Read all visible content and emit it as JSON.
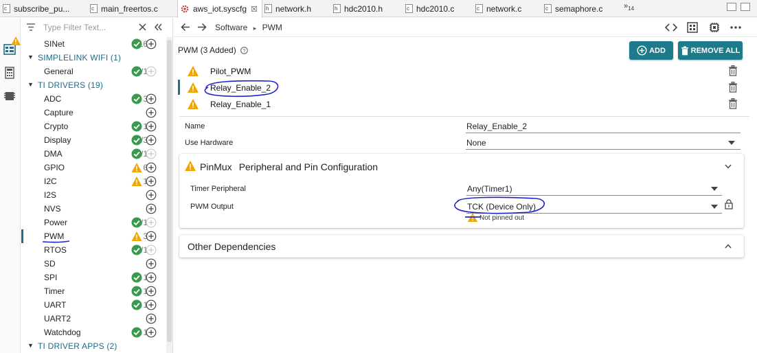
{
  "tabs": [
    {
      "label": "subscribe_pu...",
      "type": "c"
    },
    {
      "label": "main_freertos.c",
      "type": "c"
    },
    {
      "label": "aws_iot.syscfg",
      "type": "cfg",
      "active": true,
      "close": "☒"
    },
    {
      "label": "network.h",
      "type": "h"
    },
    {
      "label": "hdc2010.h",
      "type": "h"
    },
    {
      "label": "hdc2010.c",
      "type": "c"
    },
    {
      "label": "network.c",
      "type": "c"
    },
    {
      "label": "semaphore.c",
      "type": "c"
    }
  ],
  "tab_overflow": {
    "symbol": "»",
    "count": "14"
  },
  "filter": {
    "placeholder": "Type Filter Text..."
  },
  "tree": {
    "rows": [
      {
        "kind": "item",
        "name": "SINet",
        "count": "1/16",
        "status": "ok",
        "add": "active"
      },
      {
        "kind": "cat",
        "name": "SIMPLELINK WIFI (1)"
      },
      {
        "kind": "item",
        "name": "General",
        "count": "1/1",
        "status": "ok",
        "add": "disabled"
      },
      {
        "kind": "cat",
        "name": "TI DRIVERS (19)"
      },
      {
        "kind": "item",
        "name": "ADC",
        "count": "3",
        "status": "ok",
        "add": "active"
      },
      {
        "kind": "item",
        "name": "Capture",
        "count": "",
        "status": "none",
        "add": "active"
      },
      {
        "kind": "item",
        "name": "Crypto",
        "count": "1",
        "status": "ok",
        "add": "active"
      },
      {
        "kind": "item",
        "name": "Display",
        "count": "1/3",
        "status": "ok",
        "add": "active"
      },
      {
        "kind": "item",
        "name": "DMA",
        "count": "1/1",
        "status": "ok",
        "add": "disabled"
      },
      {
        "kind": "item",
        "name": "GPIO",
        "count": "6",
        "status": "warn",
        "add": "active"
      },
      {
        "kind": "item",
        "name": "I2C",
        "count": "1",
        "status": "warn",
        "add": "active"
      },
      {
        "kind": "item",
        "name": "I2S",
        "count": "",
        "status": "none",
        "add": "active"
      },
      {
        "kind": "item",
        "name": "NVS",
        "count": "",
        "status": "none",
        "add": "active"
      },
      {
        "kind": "item",
        "name": "Power",
        "count": "1/1",
        "status": "ok",
        "add": "disabled"
      },
      {
        "kind": "item",
        "name": "PWM",
        "count": "3",
        "status": "warn",
        "add": "active",
        "selected": true
      },
      {
        "kind": "item",
        "name": "RTOS",
        "count": "1/1",
        "status": "ok",
        "add": "disabled"
      },
      {
        "kind": "item",
        "name": "SD",
        "count": "",
        "status": "none",
        "add": "active"
      },
      {
        "kind": "item",
        "name": "SPI",
        "count": "1",
        "status": "ok",
        "add": "active"
      },
      {
        "kind": "item",
        "name": "Timer",
        "count": "1",
        "status": "ok",
        "add": "active"
      },
      {
        "kind": "item",
        "name": "UART",
        "count": "1",
        "status": "ok",
        "add": "active"
      },
      {
        "kind": "item",
        "name": "UART2",
        "count": "",
        "status": "none",
        "add": "active"
      },
      {
        "kind": "item",
        "name": "Watchdog",
        "count": "1",
        "status": "ok",
        "add": "active"
      },
      {
        "kind": "cat",
        "name": "TI DRIVER APPS (2)"
      }
    ]
  },
  "breadcrumb": {
    "root": "Software",
    "sep": "▸",
    "leaf": "PWM"
  },
  "module": {
    "header": "PWM (3 Added)",
    "add_label": "ADD",
    "remove_all_label": "REMOVE ALL",
    "instances": [
      {
        "name": "Pilot_PWM",
        "selected": false
      },
      {
        "name": "Relay_Enable_2",
        "selected": true
      },
      {
        "name": "Relay_Enable_1",
        "selected": false
      }
    ]
  },
  "properties": {
    "name_label": "Name",
    "name_value": "Relay_Enable_2",
    "hw_label": "Use Hardware",
    "hw_value": "None"
  },
  "pinmux": {
    "title": "PinMux",
    "subtitle": "Peripheral and Pin Configuration",
    "timer_label": "Timer Peripheral",
    "timer_value": "Any(Timer1)",
    "pwm_label": "PWM Output",
    "pwm_value": "TCK (Device Only)",
    "note": "Not pinned out"
  },
  "dependencies": {
    "title": "Other Dependencies"
  },
  "colors": {
    "accent": "#1e7b8c",
    "ok": "#3a9a4f",
    "warn": "#f0a500",
    "category": "#1b6c8a",
    "annotation": "#1d22c9"
  }
}
